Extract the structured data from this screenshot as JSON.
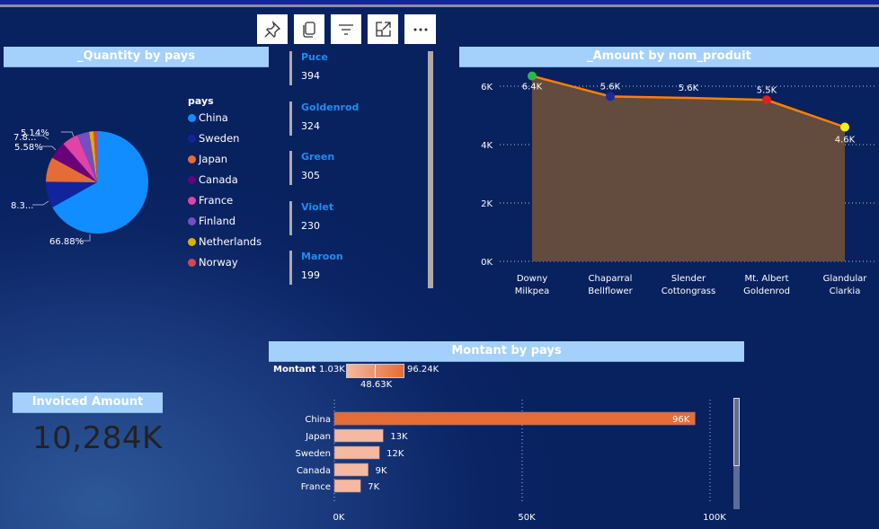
{
  "toolbar": {
    "buttons": [
      {
        "icon": "pin-icon"
      },
      {
        "icon": "copy-icon"
      },
      {
        "icon": "filter-icon"
      },
      {
        "icon": "focus-mode-icon"
      },
      {
        "icon": "more-options-icon"
      }
    ]
  },
  "pie": {
    "title": "_Quantity by pays",
    "legend_title": "pays",
    "slices": [
      {
        "name": "China",
        "pct": 66.88,
        "label": "66.88%",
        "color": "#118dff"
      },
      {
        "name": "Sweden",
        "pct": 8.3,
        "label": "8.3...",
        "color": "#12239e"
      },
      {
        "name": "Japan",
        "pct": 7.8,
        "label": "7.8...",
        "color": "#e66c37"
      },
      {
        "name": "Canada",
        "pct": 5.58,
        "label": "5.58%",
        "color": "#6b007b"
      },
      {
        "name": "France",
        "pct": 5.14,
        "label": "5.14%",
        "color": "#e044a7"
      },
      {
        "name": "Finland",
        "pct": 3.8,
        "label": "",
        "color": "#744ec2"
      },
      {
        "name": "Netherlands",
        "pct": 1.4,
        "label": "",
        "color": "#d9b300"
      },
      {
        "name": "Norway",
        "pct": 1.1,
        "label": "",
        "color": "#d64550"
      }
    ]
  },
  "cards": [
    {
      "title": "Puce",
      "value": "394"
    },
    {
      "title": "Goldenrod",
      "value": "324"
    },
    {
      "title": "Green",
      "value": "305"
    },
    {
      "title": "Violet",
      "value": "230"
    },
    {
      "title": "Maroon",
      "value": "199"
    }
  ],
  "chart_data": [
    {
      "type": "area",
      "title": "_Amount by nom_produit",
      "categories": [
        "Downy Milkpea",
        "Chaparral Bellflower",
        "Slender Cottongrass",
        "Mt. Albert Goldenrod",
        "Glandular Clarkia"
      ],
      "category_lines": [
        [
          "Downy",
          "Milkpea"
        ],
        [
          "Chaparral",
          "Bellflower"
        ],
        [
          "Slender",
          "Cottongrass"
        ],
        [
          "Mt. Albert",
          "Goldenrod"
        ],
        [
          "Glandular",
          "Clarkia"
        ]
      ],
      "values": [
        6350,
        5650,
        5600,
        5530,
        4600
      ],
      "labels": [
        "6.4K",
        "5.6K",
        "5.6K",
        "5.5K",
        "4.6K"
      ],
      "marker_colors": [
        "#2db84a",
        "#1c2aa0",
        null,
        "#e0201b",
        "#f2f20a"
      ],
      "line_color": "#ff8000",
      "area_color": "#634b3d",
      "yticks": [
        {
          "v": 0,
          "l": "0K"
        },
        {
          "v": 2000,
          "l": "2K"
        },
        {
          "v": 4000,
          "l": "4K"
        },
        {
          "v": 6000,
          "l": "6K"
        }
      ],
      "ylim": [
        0,
        6000
      ],
      "grid": true
    },
    {
      "type": "bar",
      "orientation": "horizontal",
      "title": "Montant by pays",
      "categories": [
        "China",
        "Japan",
        "Sweden",
        "Canada",
        "France"
      ],
      "values": [
        96,
        13,
        12,
        9,
        7
      ],
      "labels": [
        "96K",
        "13K",
        "12K",
        "9K",
        "7K"
      ],
      "xticks": [
        {
          "v": 0,
          "l": "0K"
        },
        {
          "v": 50,
          "l": "50K"
        },
        {
          "v": 100,
          "l": "100K"
        }
      ],
      "xlim": [
        0,
        100
      ],
      "grid": true,
      "legend": {
        "title": "Montant",
        "min": "1.03K",
        "max": "96.24K",
        "mid": "48.63K",
        "low_color": "#f4b9a0",
        "high_color": "#e66c37"
      }
    }
  ],
  "kpi": {
    "title": "Invoiced Amount",
    "value": "10,284K"
  }
}
